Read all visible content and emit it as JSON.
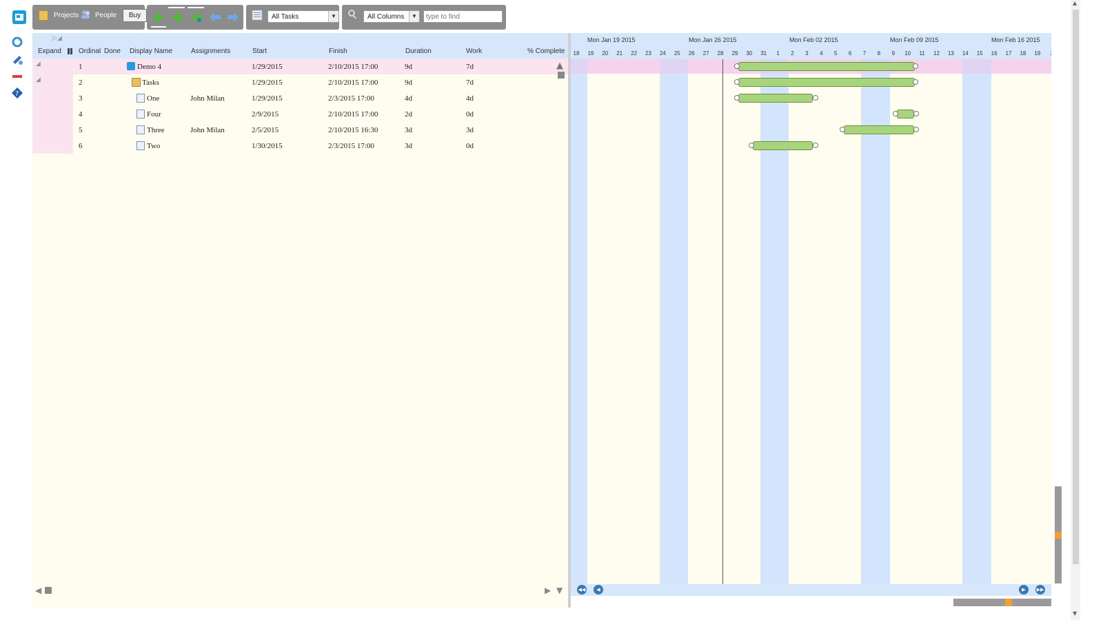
{
  "toolbar": {
    "projects_label": "Projects",
    "people_label": "People",
    "buy_label": "Buy",
    "filter_value": "All Tasks",
    "column_filter_value": "All Columns",
    "search_placeholder": "type to find"
  },
  "columns": [
    "Expand",
    "Ordinal",
    "Done",
    "Display Name",
    "Assignments",
    "Start",
    "Finish",
    "Duration",
    "Work",
    "% Complete"
  ],
  "rows": [
    {
      "ordinal": "1",
      "name": "Demo 4",
      "assign": "",
      "start": "1/29/2015",
      "finish": "2/10/2015 17:00",
      "duration": "9d",
      "work": "7d"
    },
    {
      "ordinal": "2",
      "name": "Tasks",
      "assign": "",
      "start": "1/29/2015",
      "finish": "2/10/2015 17:00",
      "duration": "9d",
      "work": "7d"
    },
    {
      "ordinal": "3",
      "name": "One",
      "assign": "John Milan",
      "start": "1/29/2015",
      "finish": "2/3/2015 17:00",
      "duration": "4d",
      "work": "4d"
    },
    {
      "ordinal": "4",
      "name": "Four",
      "assign": "",
      "start": "2/9/2015",
      "finish": "2/10/2015 17:00",
      "duration": "2d",
      "work": "0d"
    },
    {
      "ordinal": "5",
      "name": "Three",
      "assign": "John Milan",
      "start": "2/5/2015",
      "finish": "2/10/2015 16:30",
      "duration": "3d",
      "work": "3d"
    },
    {
      "ordinal": "6",
      "name": "Two",
      "assign": "",
      "start": "1/30/2015",
      "finish": "2/3/2015 17:00",
      "duration": "3d",
      "work": "0d"
    }
  ],
  "gantt": {
    "weeks": [
      "Mon Jan 19 2015",
      "Mon Jan 26 2015",
      "Mon Feb 02 2015",
      "Mon Feb 09 2015",
      "Mon Feb 16 2015"
    ],
    "days": [
      "18",
      "19",
      "20",
      "21",
      "22",
      "23",
      "24",
      "25",
      "26",
      "27",
      "28",
      "29",
      "30",
      "31",
      "1",
      "2",
      "3",
      "4",
      "5",
      "6",
      "7",
      "8",
      "9",
      "10",
      "11",
      "12",
      "13",
      "14",
      "15",
      "16",
      "17",
      "18",
      "19",
      "2"
    ]
  },
  "colors": {
    "header_bg": "#d6e6fb",
    "grid_bg": "#fffdef",
    "row_highlight": "#fbe3ef",
    "bar_fill": "#a8d47b",
    "weekend": "#d3e5fd"
  }
}
